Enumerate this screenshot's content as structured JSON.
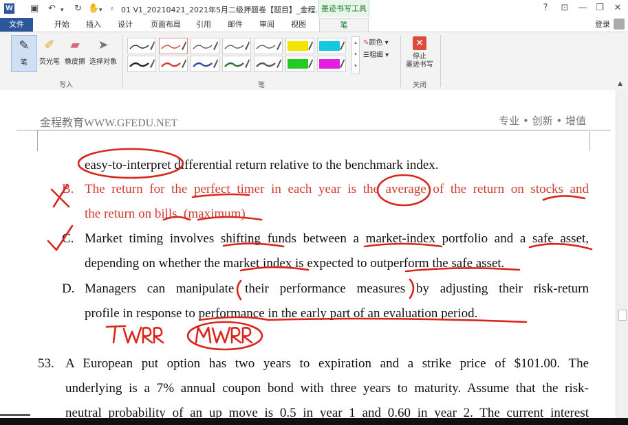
{
  "app": {
    "logo_text": "W",
    "title": "01 V1_20210421_2021年5月二级押题卷【题目】_金程...",
    "contextual_tab": "墨迹书写工具",
    "window_buttons": [
      "?",
      "⊡",
      "—",
      "❐",
      "✕"
    ]
  },
  "tabs": [
    {
      "label": "文件"
    },
    {
      "label": "开始"
    },
    {
      "label": "插入"
    },
    {
      "label": "设计"
    },
    {
      "label": "页面布局"
    },
    {
      "label": "引用"
    },
    {
      "label": "邮件"
    },
    {
      "label": "审阅"
    },
    {
      "label": "视图"
    },
    {
      "label": "笔"
    }
  ],
  "login_label": "登录",
  "ribbon": {
    "tools": [
      {
        "label": "笔",
        "icon": "pen-icon",
        "selected": true
      },
      {
        "label": "荧光笔",
        "icon": "highlighter-icon",
        "selected": false
      },
      {
        "label": "橡皮擦",
        "icon": "eraser-icon",
        "selected": false
      },
      {
        "label": "选择对象",
        "icon": "select-cursor-icon",
        "selected": false
      }
    ],
    "write_group_label": "写入",
    "pens_group_label": "笔",
    "color_label": "颜色",
    "thickness_label": "粗细",
    "close_group_label": "关闭",
    "stop_label_1": "停止",
    "stop_label_2": "墨迹书写",
    "pen_colors": [
      "#222222",
      "#d23b2f",
      "#555555",
      "#555555",
      "#555555",
      "#f2e600",
      "#16c7e0",
      "#222222",
      "#d23b2f",
      "#2b4fa0",
      "#2e6b3a",
      "#555555",
      "#22cc22",
      "#e61ee0"
    ]
  },
  "document": {
    "header_left": "金程教育WWW.GFEDU.NET",
    "header_right": "专业 • 创新 • 增值",
    "lines": [
      "easy-to-interpret differential return relative to the benchmark index.",
      "B.",
      "The return for the perfect timer in each year is the average of the return on stocks and",
      "the return on bills. (maximum)",
      "C.",
      "Market timing involves shifting funds between a market-index portfolio and a safe asset,",
      "depending on whether the market index is expected to outperform the safe asset.",
      "D.",
      "Managers can manipulate their performance measures by adjusting their risk-return",
      "profile in response to performance in the early part of an evaluation period.",
      "53.",
      "A European put option has two years to expiration and a strike price of $101.00. The",
      "underlying is a 7% annual coupon bond with three years to maturity. Assume that the risk-",
      "neutral probability of an up move is 0.5 in year 1 and 0.60 in year 2. The current interest"
    ],
    "handwritten": [
      "TWRR",
      "MWRR"
    ]
  }
}
